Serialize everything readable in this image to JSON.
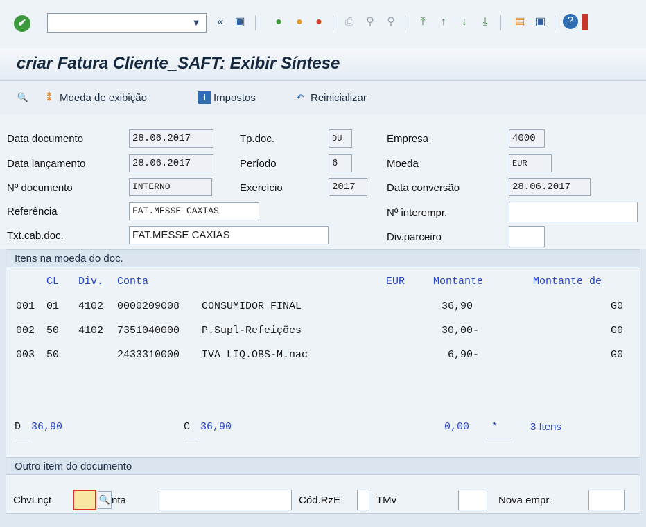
{
  "toolbar": {
    "command_field_value": "",
    "icons": [
      "ok-icon",
      "back-double-icon",
      "save-icon",
      "back-icon",
      "exit-icon",
      "cancel-icon",
      "print-icon",
      "find-icon",
      "find-next-icon",
      "first-page-icon",
      "prev-page-icon",
      "next-page-icon",
      "last-page-icon",
      "new-session-icon",
      "shortcut-icon",
      "help-icon"
    ]
  },
  "title": "criar Fatura Cliente_SAFT: Exibir Síntese",
  "app_toolbar": {
    "currency_label": "Moeda de exibição",
    "taxes_label": "Impostos",
    "reset_label": "Reinicializar"
  },
  "header": {
    "data_documento_label": "Data documento",
    "data_documento": "28.06.2017",
    "tp_doc_label": "Tp.doc.",
    "tp_doc": "DU",
    "empresa_label": "Empresa",
    "empresa": "4000",
    "data_lancamento_label": "Data lançamento",
    "data_lancamento": "28.06.2017",
    "periodo_label": "Período",
    "periodo": "6",
    "moeda_label": "Moeda",
    "moeda": "EUR",
    "n_documento_label": "Nº documento",
    "n_documento": "INTERNO",
    "exercicio_label": "Exercício",
    "exercicio": "2017",
    "data_conversao_label": "Data conversão",
    "data_conversao": "28.06.2017",
    "referencia_label": "Referência",
    "referencia": "FAT.MESSE CAXIAS",
    "n_interempr_label": "Nº interempr.",
    "n_interempr": "",
    "txt_cab_label": "Txt.cab.doc.",
    "txt_cab": "FAT.MESSE CAXIAS",
    "div_parceiro_label": "Div.parceiro",
    "div_parceiro": ""
  },
  "items_section": {
    "title": "Itens na moeda do doc.",
    "headers": {
      "cl": "CL",
      "div": "Div.",
      "conta": "Conta",
      "currency": "EUR",
      "montante": "Montante",
      "montante_de": "Montante de"
    },
    "rows": [
      {
        "no": "001",
        "cl": "01",
        "div": "4102",
        "conta": "0000209008",
        "desc": "CONSUMIDOR FINAL",
        "montante": "36,90",
        "tag": "G0"
      },
      {
        "no": "002",
        "cl": "50",
        "div": "4102",
        "conta": "7351040000",
        "desc": "P.Supl-Refeições",
        "montante": "30,00-",
        "tag": "G0"
      },
      {
        "no": "003",
        "cl": "50",
        "div": "",
        "conta": "2433310000",
        "desc": "IVA LIQ.OBS-M.nac",
        "montante": "6,90-",
        "tag": "G0"
      }
    ],
    "totals": {
      "d_label": "D",
      "d_value": "36,90",
      "c_label": "C",
      "c_value": "36,90",
      "balance": "0,00",
      "star": "*",
      "count": "3 Itens"
    }
  },
  "other_item": {
    "title": "Outro item do documento",
    "chv_label": "ChvLnçt",
    "conta_label": "nta",
    "rze_label": "Cód.RzE",
    "tmv_label": "TMv",
    "nova_empr_label": "Nova empr."
  }
}
